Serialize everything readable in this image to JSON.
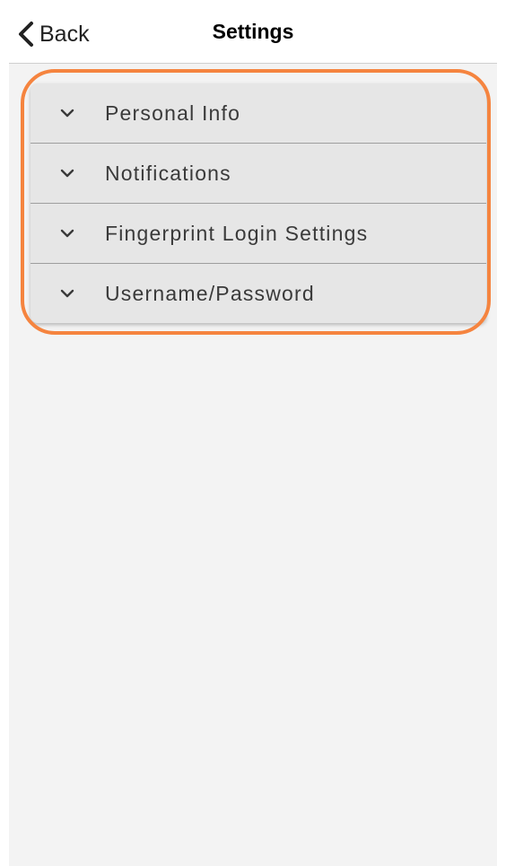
{
  "header": {
    "back_label": "Back",
    "back_icon": "chevron-left-icon",
    "title": "Settings"
  },
  "accordion": {
    "items": [
      {
        "label": "Personal Info",
        "icon": "chevron-down-icon",
        "expanded": false
      },
      {
        "label": "Notifications",
        "icon": "chevron-down-icon",
        "expanded": false
      },
      {
        "label": "Fingerprint Login Settings",
        "icon": "chevron-down-icon",
        "expanded": false
      },
      {
        "label": "Username/Password",
        "icon": "chevron-down-icon",
        "expanded": false
      }
    ]
  },
  "colors": {
    "highlight": "#f5843f",
    "background": "#f3f3f3",
    "accordion_bg": "#e6e6e6"
  }
}
